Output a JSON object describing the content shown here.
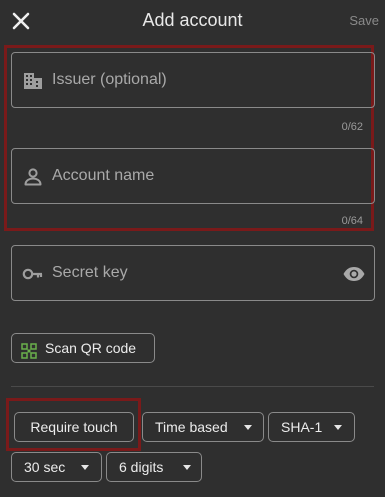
{
  "header": {
    "title": "Add account",
    "save_label": "Save",
    "close_icon": "close-icon"
  },
  "fields": {
    "issuer": {
      "placeholder": "Issuer (optional)",
      "counter": "0/62",
      "icon": "building-icon"
    },
    "account_name": {
      "placeholder": "Account name",
      "counter": "0/64",
      "icon": "person-icon"
    },
    "secret_key": {
      "placeholder": "Secret key",
      "icon": "key-icon",
      "toggle_icon": "eye-icon"
    }
  },
  "scan_button": {
    "label": "Scan QR code",
    "icon": "qr-code-icon"
  },
  "options": {
    "require_touch": "Require touch",
    "otp_type": "Time based",
    "algorithm": "SHA-1",
    "period": "30 sec",
    "digits": "6 digits"
  },
  "colors": {
    "background": "#2f2f2f",
    "highlight": "#7a1a1a",
    "qr_accent": "#6ab04c"
  }
}
